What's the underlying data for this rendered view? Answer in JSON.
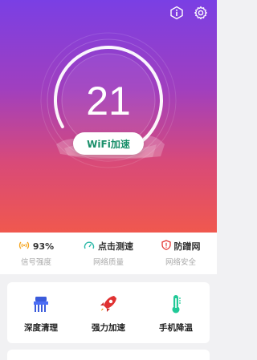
{
  "hero": {
    "score": "21",
    "button_label": "WiFi加速"
  },
  "stats": [
    {
      "icon": "wifi-signal-icon",
      "value": "93%",
      "label": "信号强度"
    },
    {
      "icon": "speedometer-icon",
      "value": "点击测速",
      "label": "网络质量"
    },
    {
      "icon": "shield-icon",
      "value": "防蹭网",
      "label": "网络安全"
    }
  ],
  "tools": [
    {
      "icon": "broom-icon",
      "label": "深度清理"
    },
    {
      "icon": "rocket-icon",
      "label": "强力加速"
    },
    {
      "icon": "thermometer-icon",
      "label": "手机降温"
    }
  ],
  "colors": {
    "gradient_top": "#7a3fe4",
    "gradient_bottom": "#f0584e",
    "accent_green": "#1a8f6a",
    "warning_orange": "#f5a623",
    "teal": "#2bb8a8",
    "red": "#e53935"
  }
}
